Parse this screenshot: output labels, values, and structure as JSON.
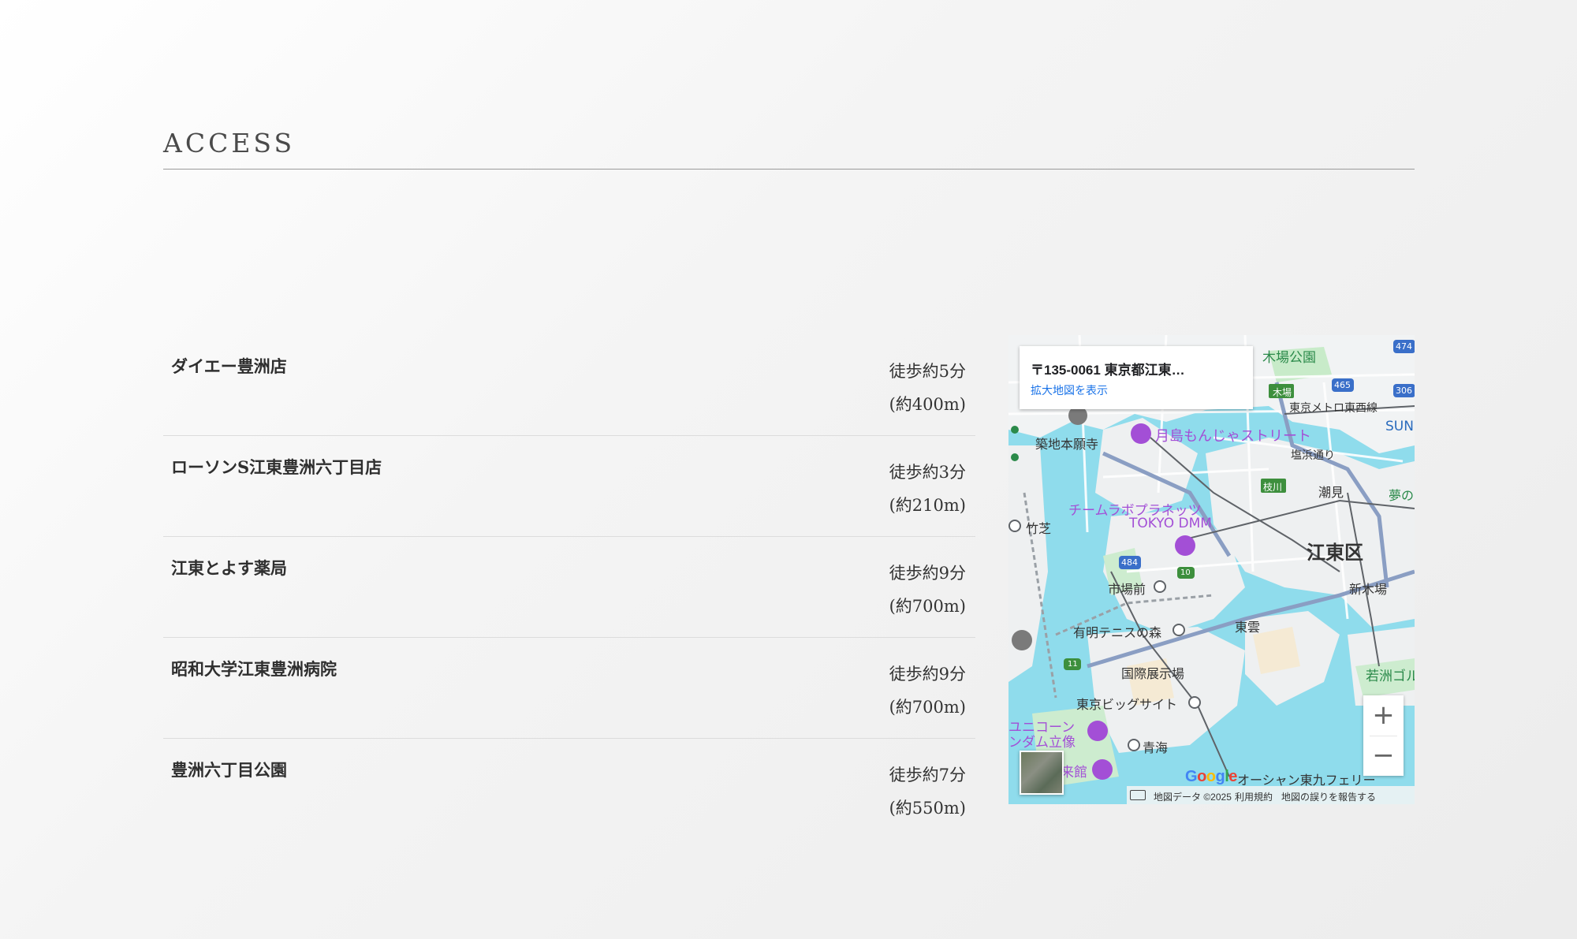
{
  "section": {
    "title": "ACCESS"
  },
  "access": [
    {
      "name": "ダイエー豊洲店",
      "walk": "徒歩約5分",
      "distance": "(約400m)"
    },
    {
      "name": "ローソンS江東豊洲六丁目店",
      "walk": "徒歩約3分",
      "distance": "(約210m)"
    },
    {
      "name": "江東とよす薬局",
      "walk": "徒歩約9分",
      "distance": "(約700m)"
    },
    {
      "name": "昭和大学江東豊洲病院",
      "walk": "徒歩約9分",
      "distance": "(約700m)"
    },
    {
      "name": "豊洲六丁目公園",
      "walk": "徒歩約7分",
      "distance": "(約550m)"
    }
  ],
  "map": {
    "info_address": "〒135-0061 東京都江東…",
    "info_link": "拡大地図を表示",
    "labels": {
      "kiba_park": "木場公園",
      "kiba": "木場",
      "tozai": "東京メトロ東西線",
      "tsukiji": "築地本願寺",
      "monja": "月島もんじゃストリート",
      "shiohama": "塩浜通り",
      "edagawa": "枝川",
      "shiomi": "潮見",
      "teamlab1": "チームラボプラネッツ",
      "teamlab2": "TOKYO DMM",
      "takeshiba": "竹芝",
      "koto": "江東区",
      "shijomae": "市場前",
      "shinkiba": "新木場",
      "ariake": "有明テニスの森",
      "shinonome": "東雲",
      "kokusai": "国際展示場",
      "bigsight": "東京ビッグサイト",
      "wakasu": "若洲ゴル",
      "unicorn1": "ユニコーン",
      "unicorn2": "ンダム立像",
      "aomi": "青海",
      "kaikan": "来館",
      "ferry": "オーシャン東九フェリー",
      "yume": "夢の",
      "sun": "SUN",
      "route_474": "474",
      "route_465": "465",
      "route_306": "306",
      "route_484": "484",
      "route_10": "10",
      "route_11": "11"
    },
    "google": [
      "G",
      "o",
      "o",
      "g",
      "l",
      "e"
    ],
    "google_colors": [
      "#4285F4",
      "#EA4335",
      "#FBBC05",
      "#4285F4",
      "#34A853",
      "#EA4335"
    ],
    "footer": {
      "data": "地図データ ©2025",
      "terms": "利用規約",
      "report": "地図の誤りを報告する"
    },
    "zoom_in": "+",
    "zoom_out": "−"
  }
}
